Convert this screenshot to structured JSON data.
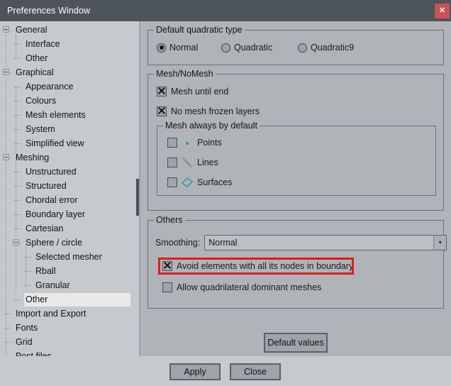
{
  "window": {
    "title": "Preferences Window",
    "close_icon": "close-icon",
    "close_label": "✕"
  },
  "sidebar": {
    "items": [
      {
        "label": "General",
        "level": 0,
        "expander": "collapse",
        "selected": false
      },
      {
        "label": "Interface",
        "level": 1,
        "expander": "none",
        "selected": false
      },
      {
        "label": "Other",
        "level": 1,
        "expander": "none",
        "selected": false
      },
      {
        "label": "Graphical",
        "level": 0,
        "expander": "collapse",
        "selected": false
      },
      {
        "label": "Appearance",
        "level": 1,
        "expander": "none",
        "selected": false
      },
      {
        "label": "Colours",
        "level": 1,
        "expander": "none",
        "selected": false
      },
      {
        "label": "Mesh elements",
        "level": 1,
        "expander": "none",
        "selected": false
      },
      {
        "label": "System",
        "level": 1,
        "expander": "none",
        "selected": false
      },
      {
        "label": "Simplified view",
        "level": 1,
        "expander": "none",
        "selected": false
      },
      {
        "label": "Meshing",
        "level": 0,
        "expander": "collapse",
        "selected": false
      },
      {
        "label": "Unstructured",
        "level": 1,
        "expander": "none",
        "selected": false
      },
      {
        "label": "Structured",
        "level": 1,
        "expander": "none",
        "selected": false
      },
      {
        "label": "Chordal error",
        "level": 1,
        "expander": "none",
        "selected": false
      },
      {
        "label": "Boundary layer",
        "level": 1,
        "expander": "none",
        "selected": false
      },
      {
        "label": "Cartesian",
        "level": 1,
        "expander": "none",
        "selected": false
      },
      {
        "label": "Sphere / circle",
        "level": 1,
        "expander": "collapse",
        "selected": false
      },
      {
        "label": "Selected mesher",
        "level": 2,
        "expander": "none",
        "selected": false
      },
      {
        "label": "Rball",
        "level": 2,
        "expander": "none",
        "selected": false
      },
      {
        "label": "Granular",
        "level": 2,
        "expander": "none",
        "selected": false
      },
      {
        "label": "Other",
        "level": 1,
        "expander": "none",
        "selected": true
      },
      {
        "label": "Import and Export",
        "level": 0,
        "expander": "none",
        "selected": false
      },
      {
        "label": "Fonts",
        "level": 0,
        "expander": "none",
        "selected": false
      },
      {
        "label": "Grid",
        "level": 0,
        "expander": "none",
        "selected": false
      },
      {
        "label": "Post files",
        "level": 0,
        "expander": "none",
        "selected": false
      }
    ]
  },
  "quadratic_group": {
    "legend": "Default quadratic type",
    "options": [
      {
        "label": "Normal",
        "checked": true
      },
      {
        "label": "Quadratic",
        "checked": false
      },
      {
        "label": "Quadratic9",
        "checked": false
      }
    ]
  },
  "mesh_group": {
    "legend": "Mesh/NoMesh",
    "checks": [
      {
        "label": "Mesh until end",
        "checked": true
      },
      {
        "label": "No mesh frozen layers",
        "checked": true
      }
    ],
    "default_group": {
      "legend": "Mesh always by default",
      "items": [
        {
          "label": "Points",
          "checked": false,
          "icon": "point-icon"
        },
        {
          "label": "Lines",
          "checked": false,
          "icon": "line-icon"
        },
        {
          "label": "Surfaces",
          "checked": false,
          "icon": "surface-icon"
        }
      ]
    }
  },
  "others_group": {
    "legend": "Others",
    "smoothing_label": "Smoothing:",
    "smoothing_value": "Normal",
    "combo_arrow": "▼",
    "checks": [
      {
        "label": "Avoid elements with all its nodes in boundary",
        "checked": true,
        "highlighted": true
      },
      {
        "label": "Allow quadrilateral dominant meshes",
        "checked": false,
        "highlighted": false
      }
    ]
  },
  "buttons": {
    "default_values": "Default values",
    "apply": "Apply",
    "close": "Close"
  },
  "colors": {
    "titlebar": "#4d545c",
    "close_button": "#cc5055",
    "panel": "#b0b3b8",
    "sidebar": "#c6cace",
    "bottom_bar": "#c6cacd",
    "highlight_red": "#e01b1b",
    "selection": "#e9e9e9",
    "icon_teal": "#3fb8c4"
  }
}
